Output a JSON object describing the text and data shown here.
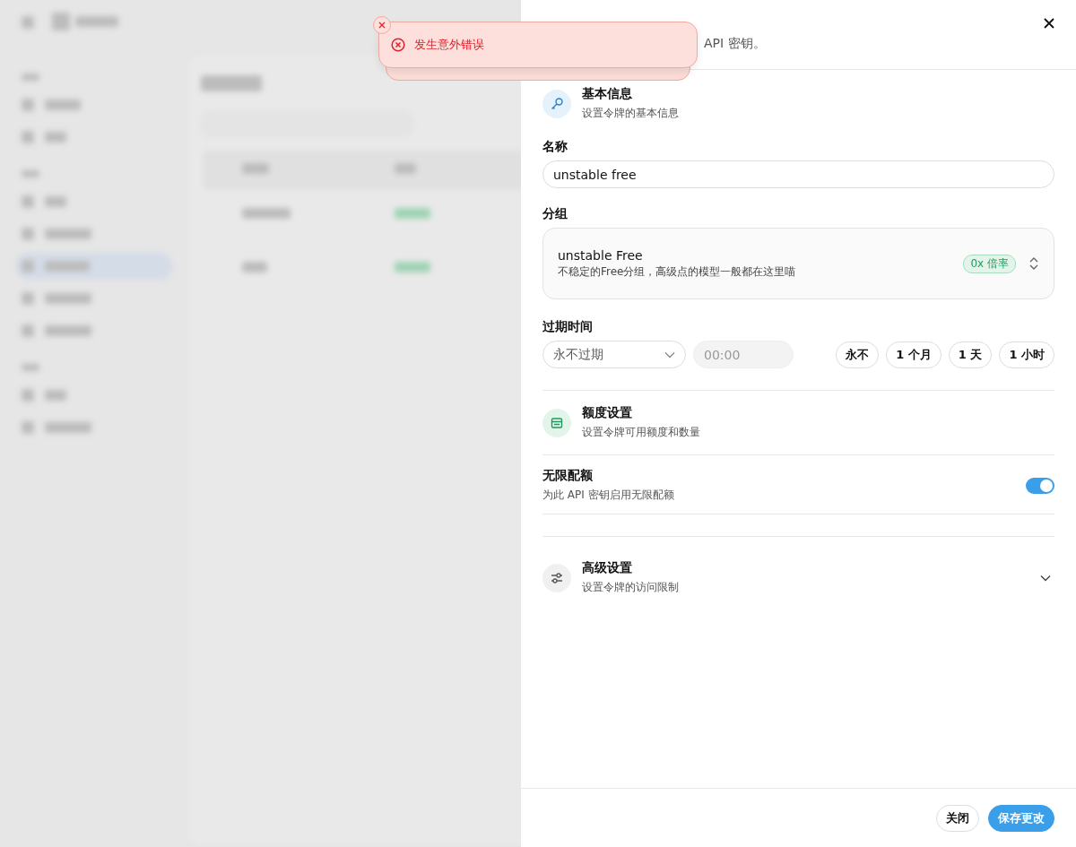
{
  "toast": {
    "kind": "error",
    "message": "发生意外错误",
    "stacked": true
  },
  "drawer": {
    "subtitle_visible": "API 密钥。",
    "basic": {
      "title": "基本信息",
      "subtitle": "设置令牌的基本信息"
    },
    "name_field": {
      "label": "名称",
      "value": "unstable free"
    },
    "group": {
      "label": "分组",
      "name": "unstable Free",
      "description": "不稳定的Free分组，高级点的模型一般都在这里喵",
      "badge": "0x 倍率"
    },
    "expiry": {
      "label": "过期时间",
      "select": "永不过期",
      "time_placeholder": "00:00",
      "presets": [
        {
          "label": "永不"
        },
        {
          "label": "1 个月"
        },
        {
          "label": "1 天"
        },
        {
          "label": "1 小时"
        }
      ]
    },
    "quota": {
      "title": "额度设置",
      "subtitle": "设置令牌可用额度和数量"
    },
    "unlimited": {
      "title": "无限配额",
      "subtitle": "为此 API 密钥启用无限配额",
      "on": true
    },
    "advanced": {
      "title": "高级设置",
      "subtitle": "设置令牌的访问限制",
      "expanded": false
    },
    "buttons": [
      {
        "label": "关闭",
        "kind": "secondary"
      },
      {
        "label": "保存更改",
        "kind": "primary"
      }
    ]
  }
}
